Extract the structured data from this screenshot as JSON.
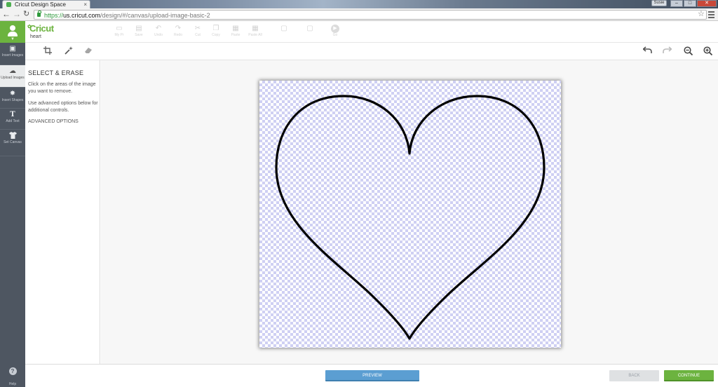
{
  "browser": {
    "tab_title": "Cricut Design Space",
    "tab_close": "×",
    "user_label": "Susie",
    "url_scheme": "https://",
    "url_host": "us.cricut.com",
    "url_path": "/design/#/canvas/upload-image-basic-2",
    "window_buttons": {
      "minimize": "–",
      "maximize": "□",
      "close": "✕"
    }
  },
  "app": {
    "logo": "Cricut",
    "project_name": "heart",
    "accent_color": "#6cb33f"
  },
  "sidebar": {
    "items": [
      {
        "label": "Insert Images",
        "icon": "image-icon"
      },
      {
        "label": "Upload Images",
        "icon": "upload-icon",
        "active": true
      },
      {
        "label": "Insert Shapes",
        "icon": "shapes-icon"
      },
      {
        "label": "Add Text",
        "icon": "text-icon"
      },
      {
        "label": "Set Canvas",
        "icon": "shirt-icon"
      }
    ],
    "help_label": "Help"
  },
  "toolbar": {
    "items": [
      "My Pr",
      "Save",
      "Undo",
      "Redo",
      "Cut",
      "Copy",
      "Paste",
      "Paste All",
      "",
      "",
      "Go"
    ]
  },
  "panel": {
    "title": "SELECT & ERASE",
    "instruction_1": "Click on the areas of the image you want to remove.",
    "instruction_2": "Use advanced options below for additional controls.",
    "advanced_options": "ADVANCED OPTIONS"
  },
  "footer": {
    "preview": "PREVIEW",
    "back": "BACK",
    "continue": "CONTINUE"
  }
}
